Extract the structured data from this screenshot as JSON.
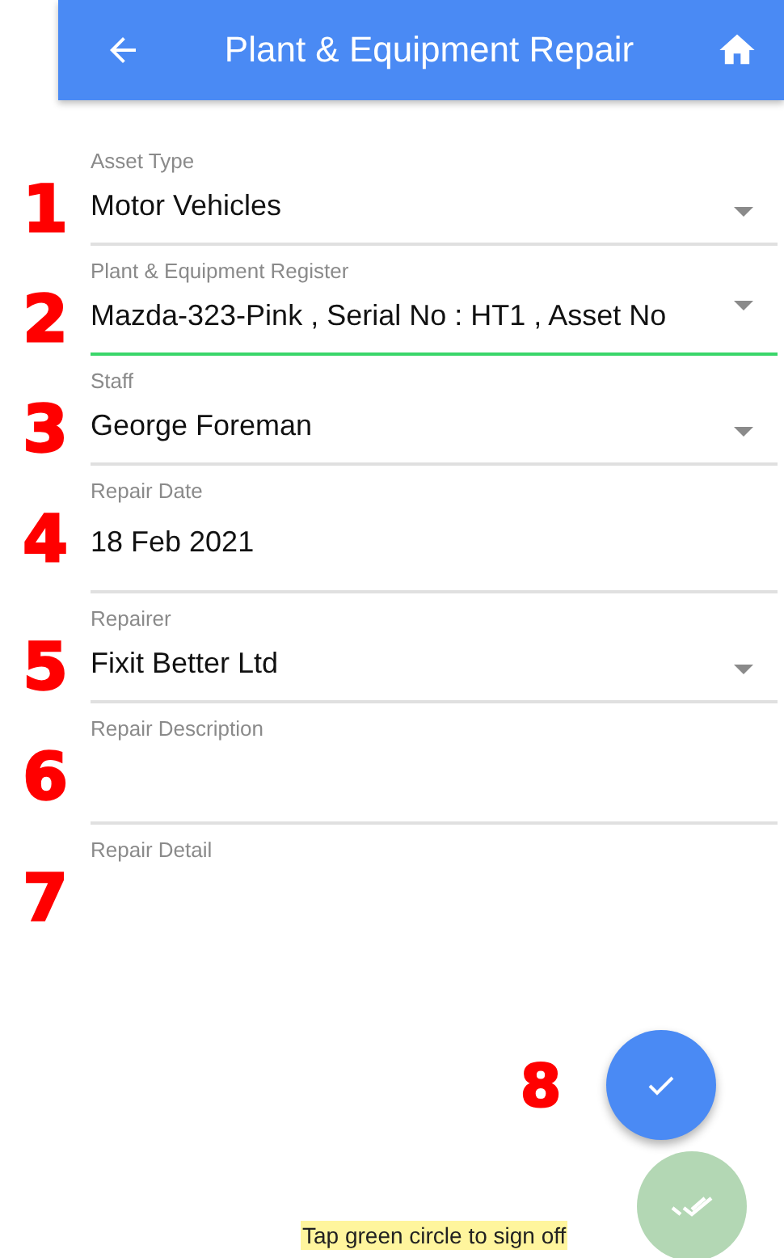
{
  "app_bar": {
    "title": "Plant & Equipment Repair"
  },
  "fields": [
    {
      "marker": "1",
      "label": "Asset Type",
      "value": "Motor Vehicles",
      "kind": "select",
      "focused": false
    },
    {
      "marker": "2",
      "label": "Plant & Equipment Register",
      "value": "Mazda-323-Pink , Serial No : HT1 , Asset No",
      "kind": "select",
      "focused": true
    },
    {
      "marker": "3",
      "label": "Staff",
      "value": "George Foreman",
      "kind": "select",
      "focused": false
    },
    {
      "marker": "4",
      "label": "Repair Date",
      "value": "18 Feb 2021",
      "kind": "date",
      "focused": false
    },
    {
      "marker": "5",
      "label": "Repairer",
      "value": "Fixit Better Ltd",
      "kind": "select",
      "focused": false
    },
    {
      "marker": "6",
      "label": "Repair Description",
      "kind": "text",
      "focused": false
    },
    {
      "marker": "7",
      "label": "Repair Detail",
      "kind": "plain",
      "focused": false
    }
  ],
  "save_marker": "8",
  "hint": "Tap green circle to sign off"
}
